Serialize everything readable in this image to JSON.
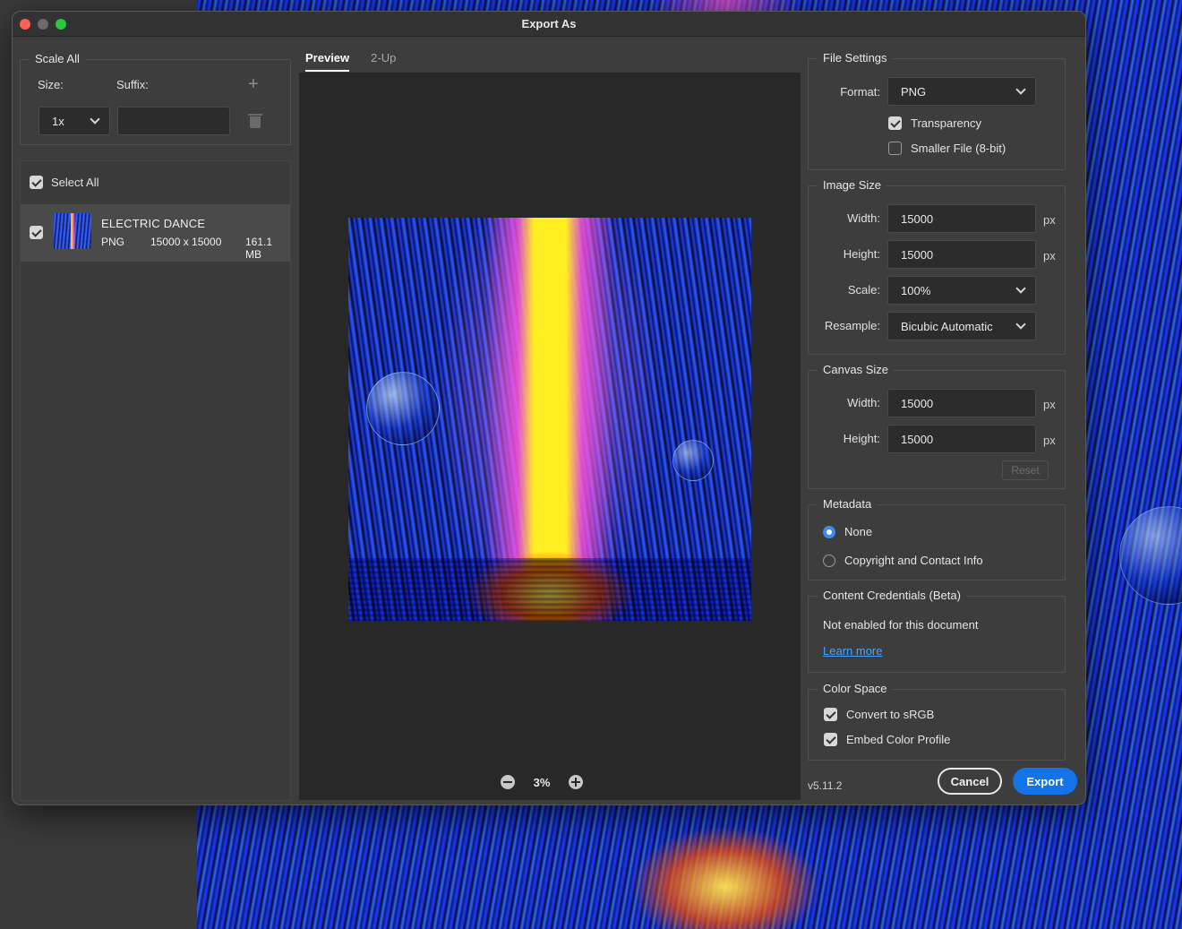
{
  "window": {
    "title": "Export As"
  },
  "scale_all": {
    "legend": "Scale All",
    "size_label": "Size:",
    "suffix_label": "Suffix:",
    "size_value": "1x",
    "suffix_value": "",
    "add_icon": "plus-icon",
    "delete_icon": "trash-icon"
  },
  "assets": {
    "select_all_label": "Select All",
    "select_all_checked": true,
    "items": [
      {
        "name": "ELECTRIC DANCE",
        "format": "PNG",
        "dimensions": "15000 x 15000",
        "size": "161.1 MB",
        "checked": true
      }
    ]
  },
  "preview": {
    "tabs": [
      {
        "label": "Preview",
        "active": true
      },
      {
        "label": "2-Up",
        "active": false
      }
    ],
    "zoom": "3%",
    "zoom_out_icon": "minus-circle-icon",
    "zoom_in_icon": "plus-circle-icon"
  },
  "file_settings": {
    "legend": "File Settings",
    "format_label": "Format:",
    "format_value": "PNG",
    "transparency_label": "Transparency",
    "transparency_checked": true,
    "smaller_file_label": "Smaller File (8-bit)",
    "smaller_file_checked": false
  },
  "image_size": {
    "legend": "Image Size",
    "width_label": "Width:",
    "width_value": "15000",
    "height_label": "Height:",
    "height_value": "15000",
    "unit": "px",
    "scale_label": "Scale:",
    "scale_value": "100%",
    "resample_label": "Resample:",
    "resample_value": "Bicubic Automatic"
  },
  "canvas_size": {
    "legend": "Canvas Size",
    "width_label": "Width:",
    "width_value": "15000",
    "height_label": "Height:",
    "height_value": "15000",
    "unit": "px",
    "reset_label": "Reset"
  },
  "metadata": {
    "legend": "Metadata",
    "options": [
      {
        "label": "None",
        "selected": true
      },
      {
        "label": "Copyright and Contact Info",
        "selected": false
      }
    ]
  },
  "content_credentials": {
    "legend": "Content Credentials (Beta)",
    "status": "Not enabled for this document",
    "learn_more": "Learn more"
  },
  "color_space": {
    "legend": "Color Space",
    "convert_label": "Convert to sRGB",
    "convert_checked": true,
    "embed_label": "Embed Color Profile",
    "embed_checked": true
  },
  "footer": {
    "version": "v5.11.2",
    "cancel_label": "Cancel",
    "export_label": "Export"
  },
  "colors": {
    "accent": "#1473e6",
    "radio_selected": "#3d8bf2",
    "link": "#4aa2ff",
    "dialog_bg": "#3d3d3d",
    "preview_bg": "#282828"
  }
}
